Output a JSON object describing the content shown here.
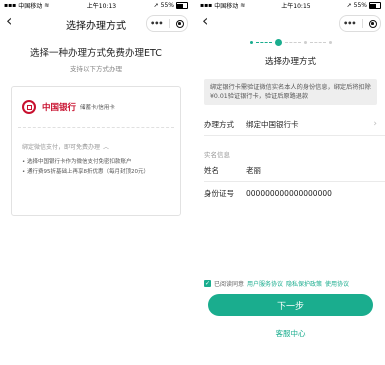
{
  "left": {
    "status": {
      "carrier": "中国移动",
      "time": "上午10:13",
      "battery": "55%"
    },
    "nav": {
      "back": "‹",
      "title": "选择办理方式"
    },
    "heading": "选择一种办理方式免费办理ETC",
    "subheading": "支持以下方式办理",
    "card": {
      "bank_name": "中国银行",
      "bank_sub": "储蓄卡/信用卡",
      "note": "绑定微信支付，即可免费办理",
      "bullets": [
        "选择中国银行卡作为微信支付免密扣款账户",
        "通行费95折基础上再享8折优惠（每月封顶20元）"
      ]
    }
  },
  "right": {
    "status": {
      "carrier": "中国移动",
      "time": "上午10:15",
      "battery": "55%"
    },
    "nav": {
      "back": "‹"
    },
    "title": "选择办理方式",
    "notice": "绑定银行卡需验证微信实名本人的身份信息，绑定后将扣除¥0.01验证银行卡，验证后原路退款",
    "method": {
      "label": "办理方式",
      "value": "绑定中国银行卡"
    },
    "section": "实名信息",
    "name": {
      "label": "姓名",
      "value": "老丽"
    },
    "id": {
      "label": "身份证号",
      "value": "000000000000000000"
    },
    "agree": {
      "prefix": "已阅读同意",
      "links": [
        "用户服务协议",
        "隐私保护政策",
        "使用协议"
      ]
    },
    "next_button": "下一步",
    "service": "客服中心"
  }
}
